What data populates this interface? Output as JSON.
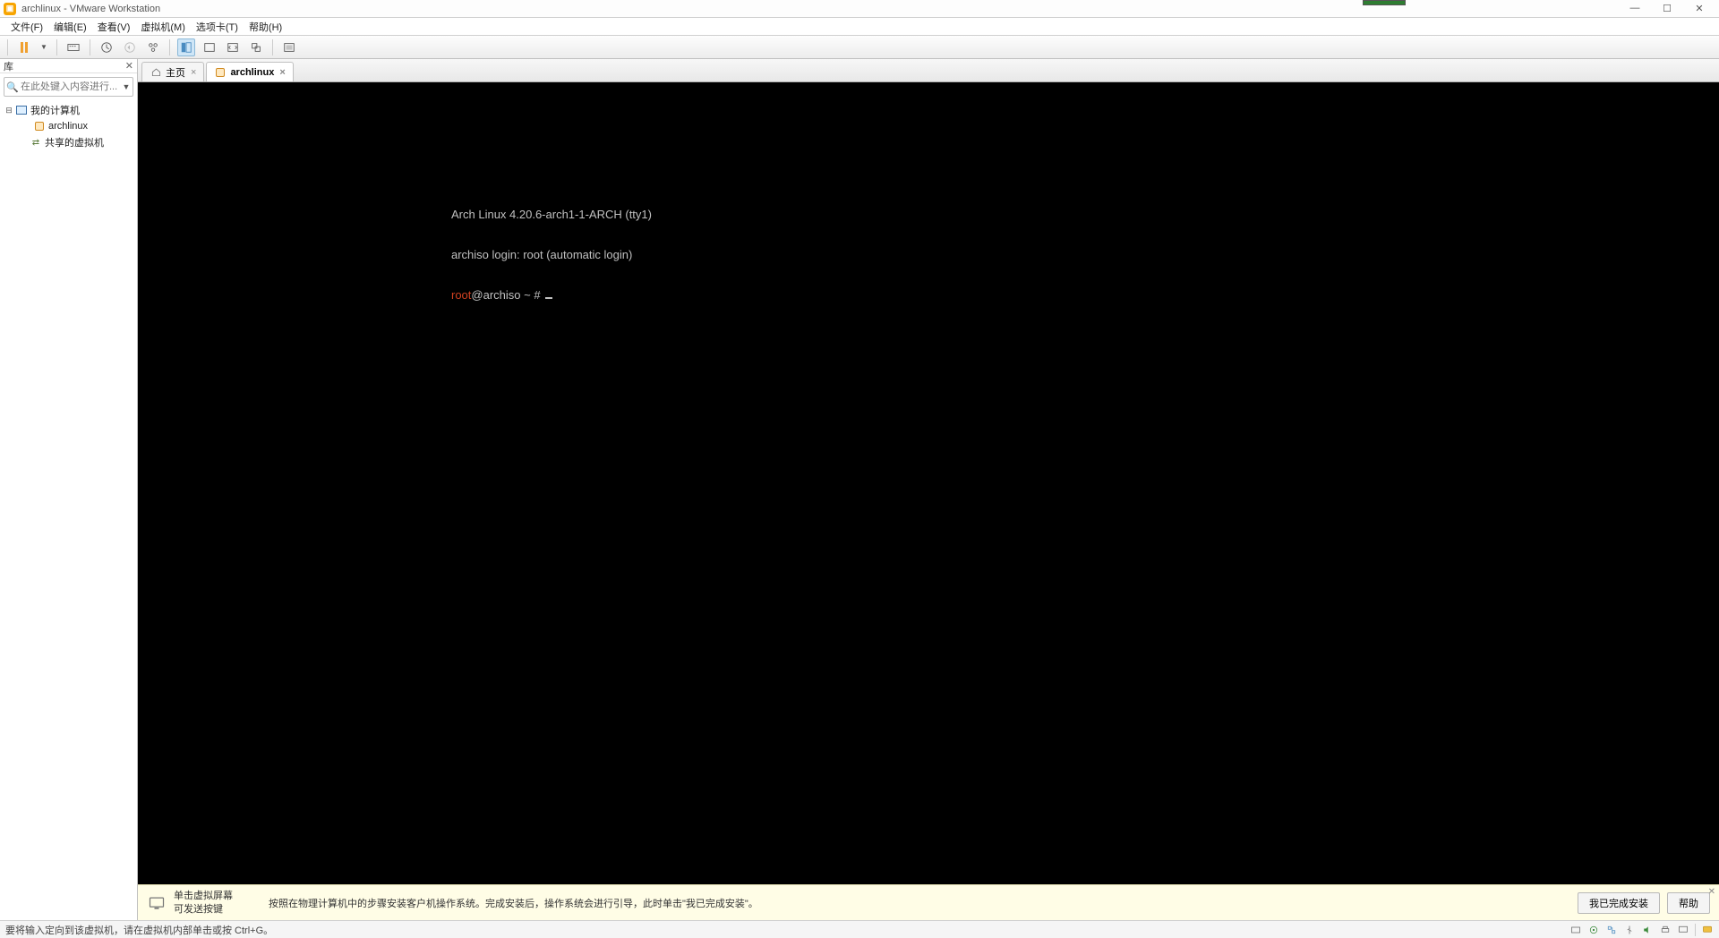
{
  "window": {
    "title": "archlinux - VMware Workstation"
  },
  "menu": {
    "file": "文件(F)",
    "edit": "编辑(E)",
    "view": "查看(V)",
    "vm": "虚拟机(M)",
    "tabs": "选项卡(T)",
    "help": "帮助(H)"
  },
  "sidebar": {
    "header_label": "库",
    "search_placeholder": "在此处键入内容进行...",
    "tree": {
      "root": "我的计算机",
      "vm": "archlinux",
      "shared": "共享的虚拟机"
    }
  },
  "tabs": {
    "home": "主页",
    "active": "archlinux"
  },
  "console": {
    "line1": "Arch Linux 4.20.6-arch1-1-ARCH (tty1)",
    "line2": "archiso login: root (automatic login)",
    "prompt_user": "root",
    "prompt_rest": "@archiso ~ # "
  },
  "infobar": {
    "title_line1": "单击虚拟屏幕",
    "title_line2": "可发送按键",
    "hint": "按照在物理计算机中的步骤安装客户机操作系统。完成安装后，操作系统会进行引导，此时单击\"我已完成安装\"。",
    "btn_done": "我已完成安装",
    "btn_help": "帮助"
  },
  "statusbar": {
    "text": "要将输入定向到该虚拟机，请在虚拟机内部单击或按 Ctrl+G。"
  }
}
